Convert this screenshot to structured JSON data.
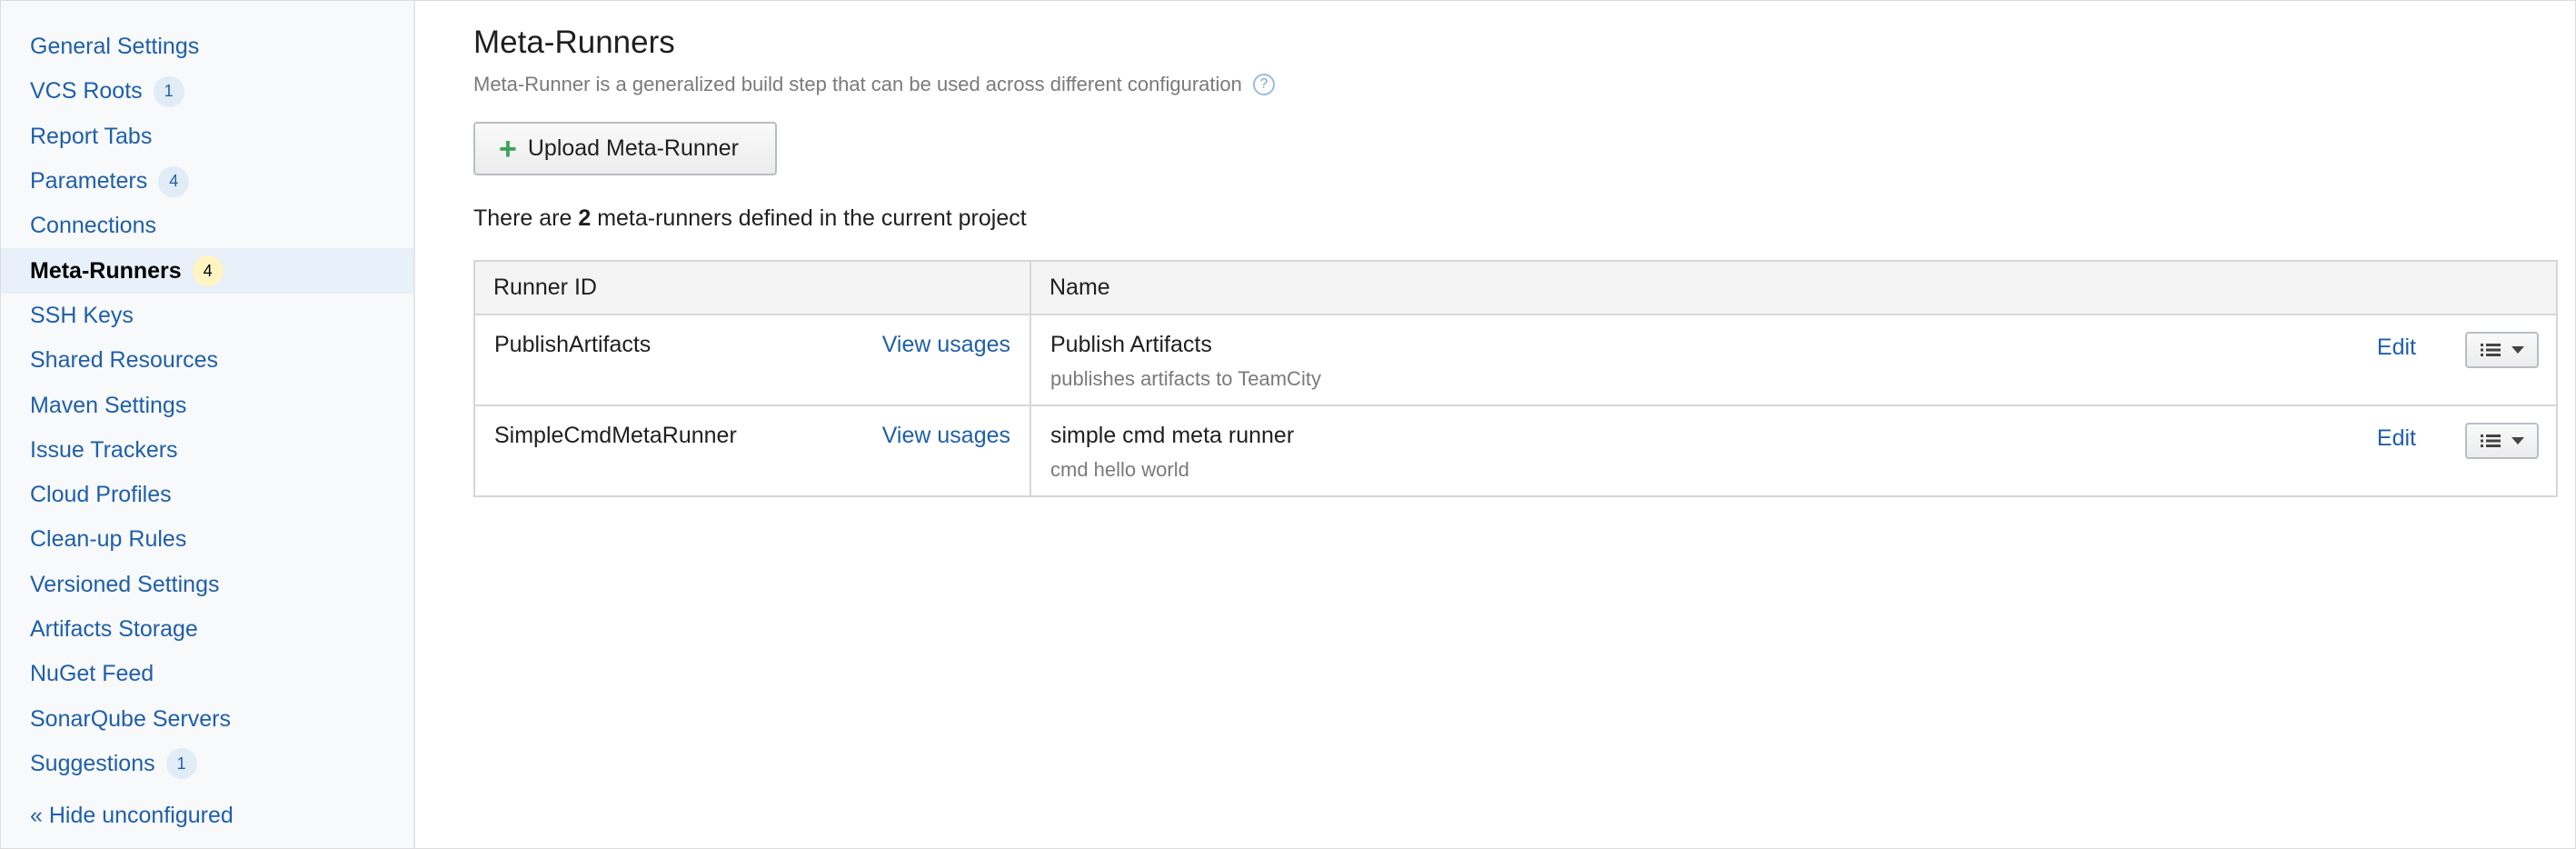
{
  "sidebar": {
    "items": [
      {
        "label": "General Settings",
        "badge": null
      },
      {
        "label": "VCS Roots",
        "badge": "1"
      },
      {
        "label": "Report Tabs",
        "badge": null
      },
      {
        "label": "Parameters",
        "badge": "4"
      },
      {
        "label": "Connections",
        "badge": null
      },
      {
        "label": "Meta-Runners",
        "badge": "4",
        "active": true
      },
      {
        "label": "SSH Keys",
        "badge": null
      },
      {
        "label": "Shared Resources",
        "badge": null
      },
      {
        "label": "Maven Settings",
        "badge": null
      },
      {
        "label": "Issue Trackers",
        "badge": null
      },
      {
        "label": "Cloud Profiles",
        "badge": null
      },
      {
        "label": "Clean-up Rules",
        "badge": null
      },
      {
        "label": "Versioned Settings",
        "badge": null
      },
      {
        "label": "Artifacts Storage",
        "badge": null
      },
      {
        "label": "NuGet Feed",
        "badge": null
      },
      {
        "label": "SonarQube Servers",
        "badge": null
      },
      {
        "label": "Suggestions",
        "badge": "1"
      }
    ],
    "hide_link": "« Hide unconfigured"
  },
  "main": {
    "title": "Meta-Runners",
    "subtitle": "Meta-Runner is a generalized build step that can be used across different configuration",
    "help_icon": "?",
    "upload_button": {
      "icon": "+",
      "label": "Upload Meta-Runner"
    },
    "summary": {
      "prefix": "There are ",
      "count": "2",
      "suffix": " meta-runners defined in the current project"
    },
    "table": {
      "headers": {
        "runner_id": "Runner ID",
        "name": "Name"
      },
      "rows": [
        {
          "id": "PublishArtifacts",
          "view_usages": "View usages",
          "name": "Publish Artifacts",
          "description": "publishes artifacts to TeamCity",
          "edit": "Edit"
        },
        {
          "id": "SimpleCmdMetaRunner",
          "view_usages": "View usages",
          "name": "simple cmd meta runner",
          "description": "cmd hello world",
          "edit": "Edit"
        }
      ]
    }
  },
  "colors": {
    "link": "#1f5fa8",
    "sidebar_bg": "#f7f9fb",
    "active_bg": "#e8f0f9",
    "plus": "#3aa35a"
  }
}
